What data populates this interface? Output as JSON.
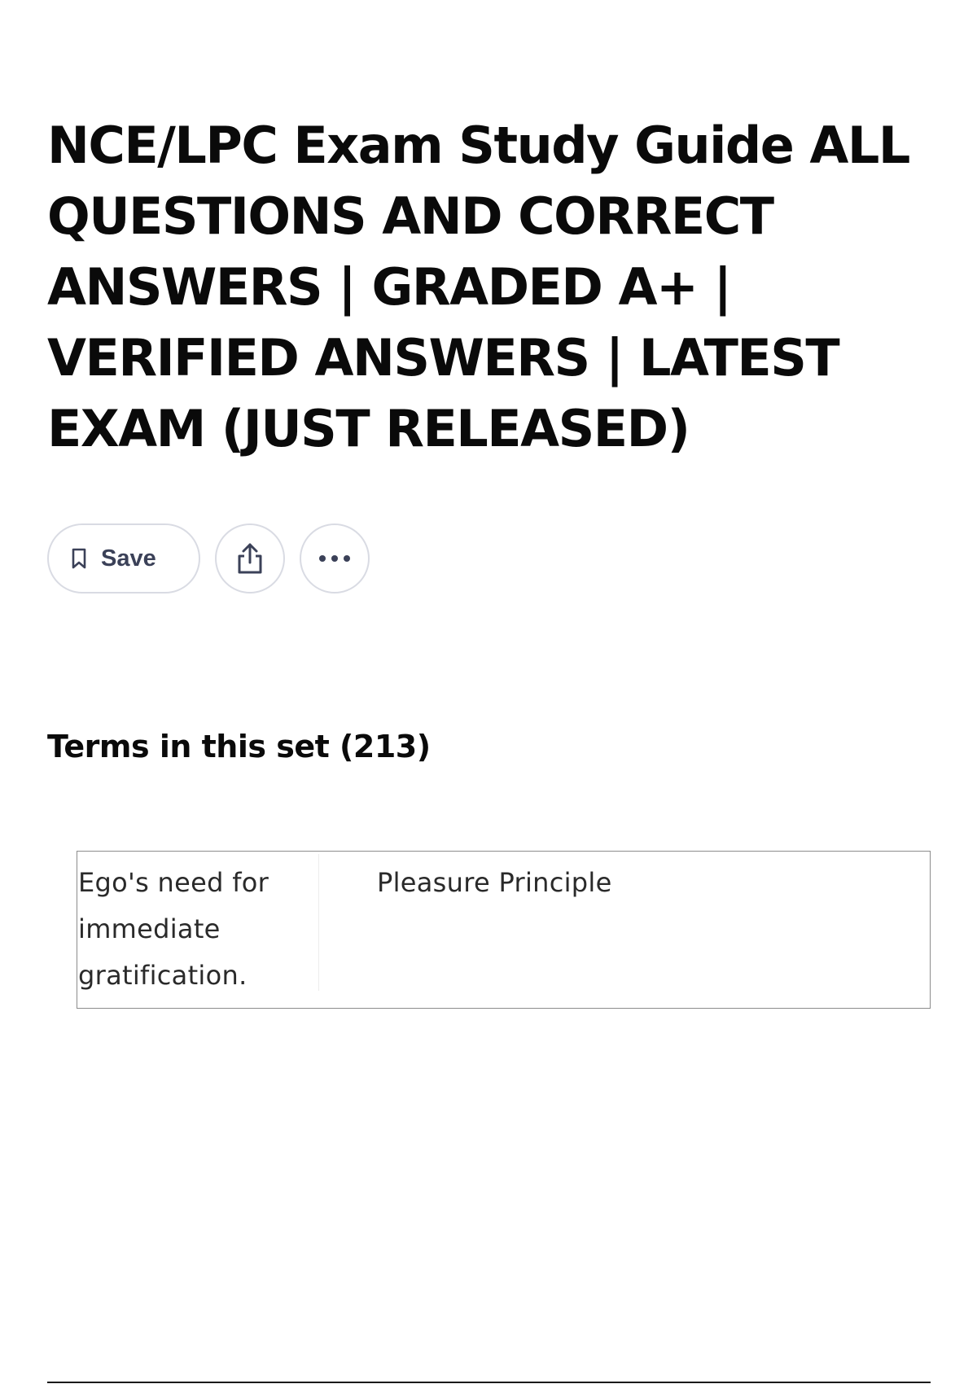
{
  "header": {
    "title": "NCE/LPC Exam Study Guide ALL QUESTIONS AND CORRECT ANSWERS | GRADED A+ | VERIFIED ANSWERS | LATEST EXAM (JUST RELEASED)"
  },
  "actions": {
    "save_label": "Save",
    "save_icon": "bookmark-icon",
    "share_icon": "share-icon",
    "more_icon": "more-horizontal-icon"
  },
  "terms": {
    "heading": "Terms in this set (213)",
    "items": [
      {
        "term": "Ego's need for immediate gratification.",
        "definition": "Pleasure Principle"
      }
    ]
  },
  "colors": {
    "text": "#0a0a0a",
    "button_text": "#3b4158",
    "button_border": "#d9dbe3",
    "card_border": "#8c8c8c"
  }
}
